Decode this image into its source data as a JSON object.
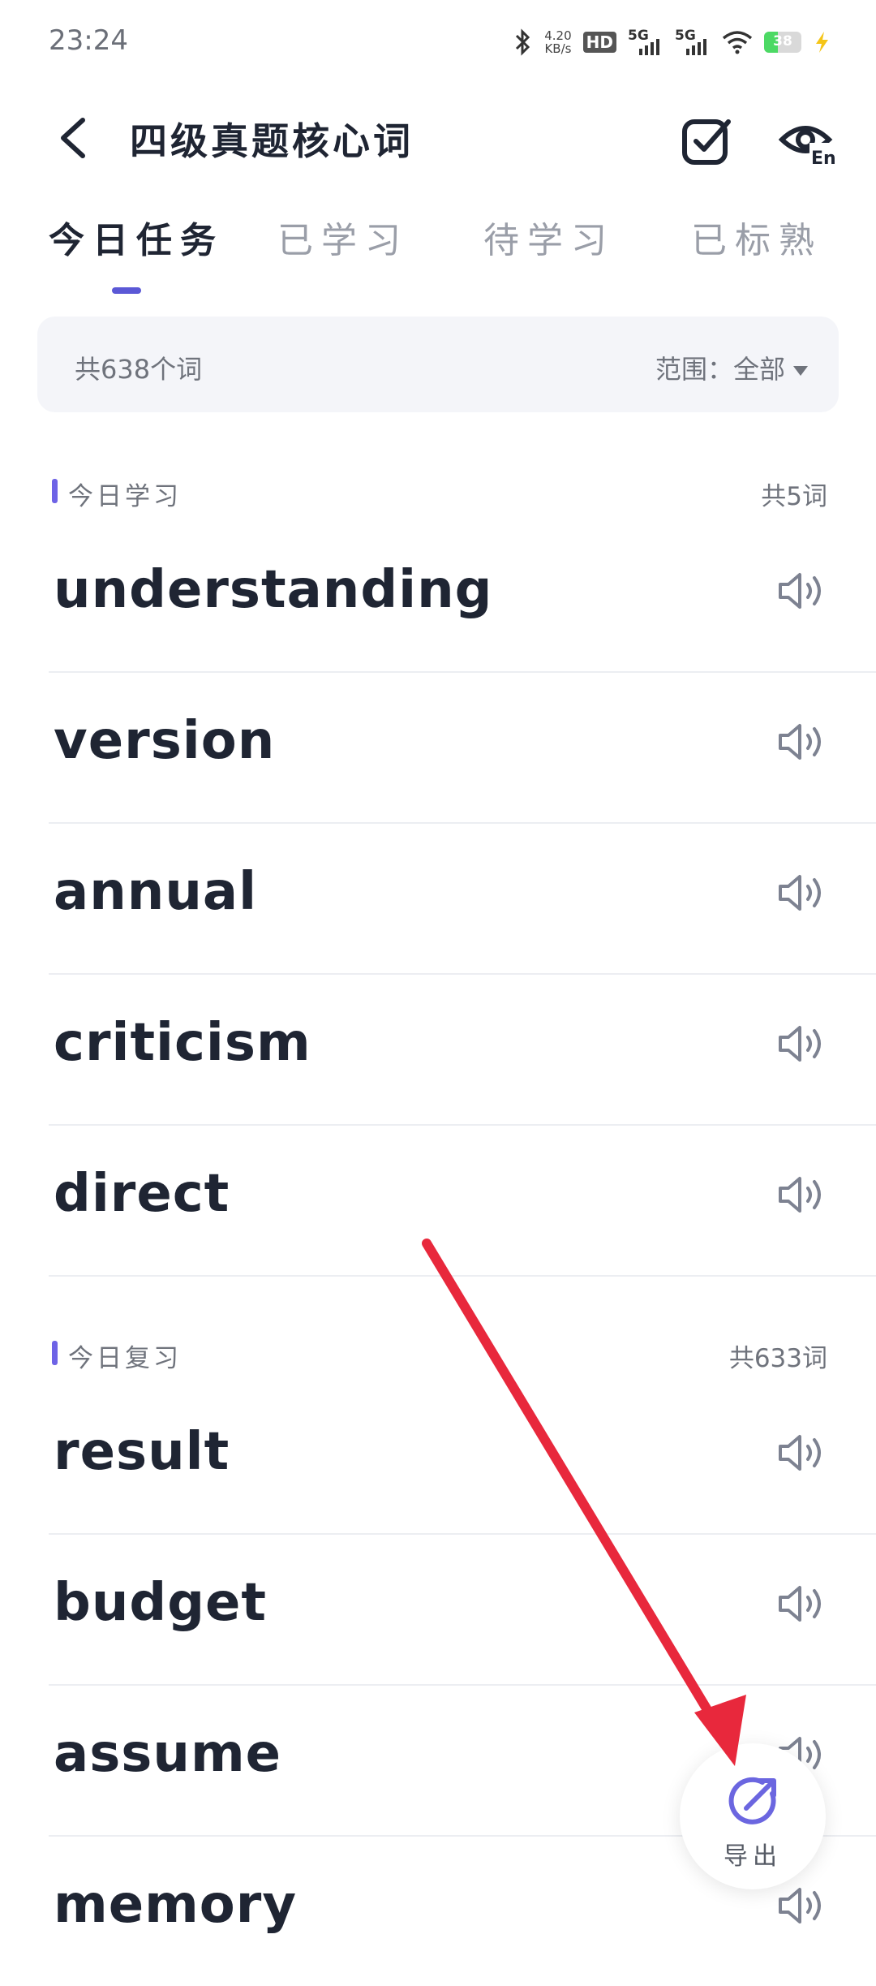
{
  "status_bar": {
    "time": "23:24",
    "net_speed": "4.20",
    "net_unit": "KB/s",
    "hd_label": "HD",
    "sim1": "5G",
    "sim2": "5G",
    "battery": "38"
  },
  "header": {
    "title": "四级真题核心词"
  },
  "tabs": [
    {
      "label": "今日任务",
      "active": true
    },
    {
      "label": "已学习",
      "active": false
    },
    {
      "label": "待学习",
      "active": false
    },
    {
      "label": "已标熟",
      "active": false
    }
  ],
  "summary": {
    "count_text": "共638个词",
    "range_label": "范围：",
    "range_value": "全部"
  },
  "today_learn": {
    "label": "今日学习",
    "total": "共5词",
    "words": [
      "understanding",
      "version",
      "annual",
      "criticism",
      "direct"
    ]
  },
  "today_review": {
    "label": "今日复习",
    "total": "共633词",
    "words": [
      "result",
      "budget",
      "assume",
      "memory"
    ]
  },
  "fab": {
    "label": "导出"
  },
  "colors": {
    "accent": "#5b58d6",
    "section_bar": "#6e63e6",
    "arrow": "#e8283c",
    "fab_icon": "#6b66e0"
  }
}
